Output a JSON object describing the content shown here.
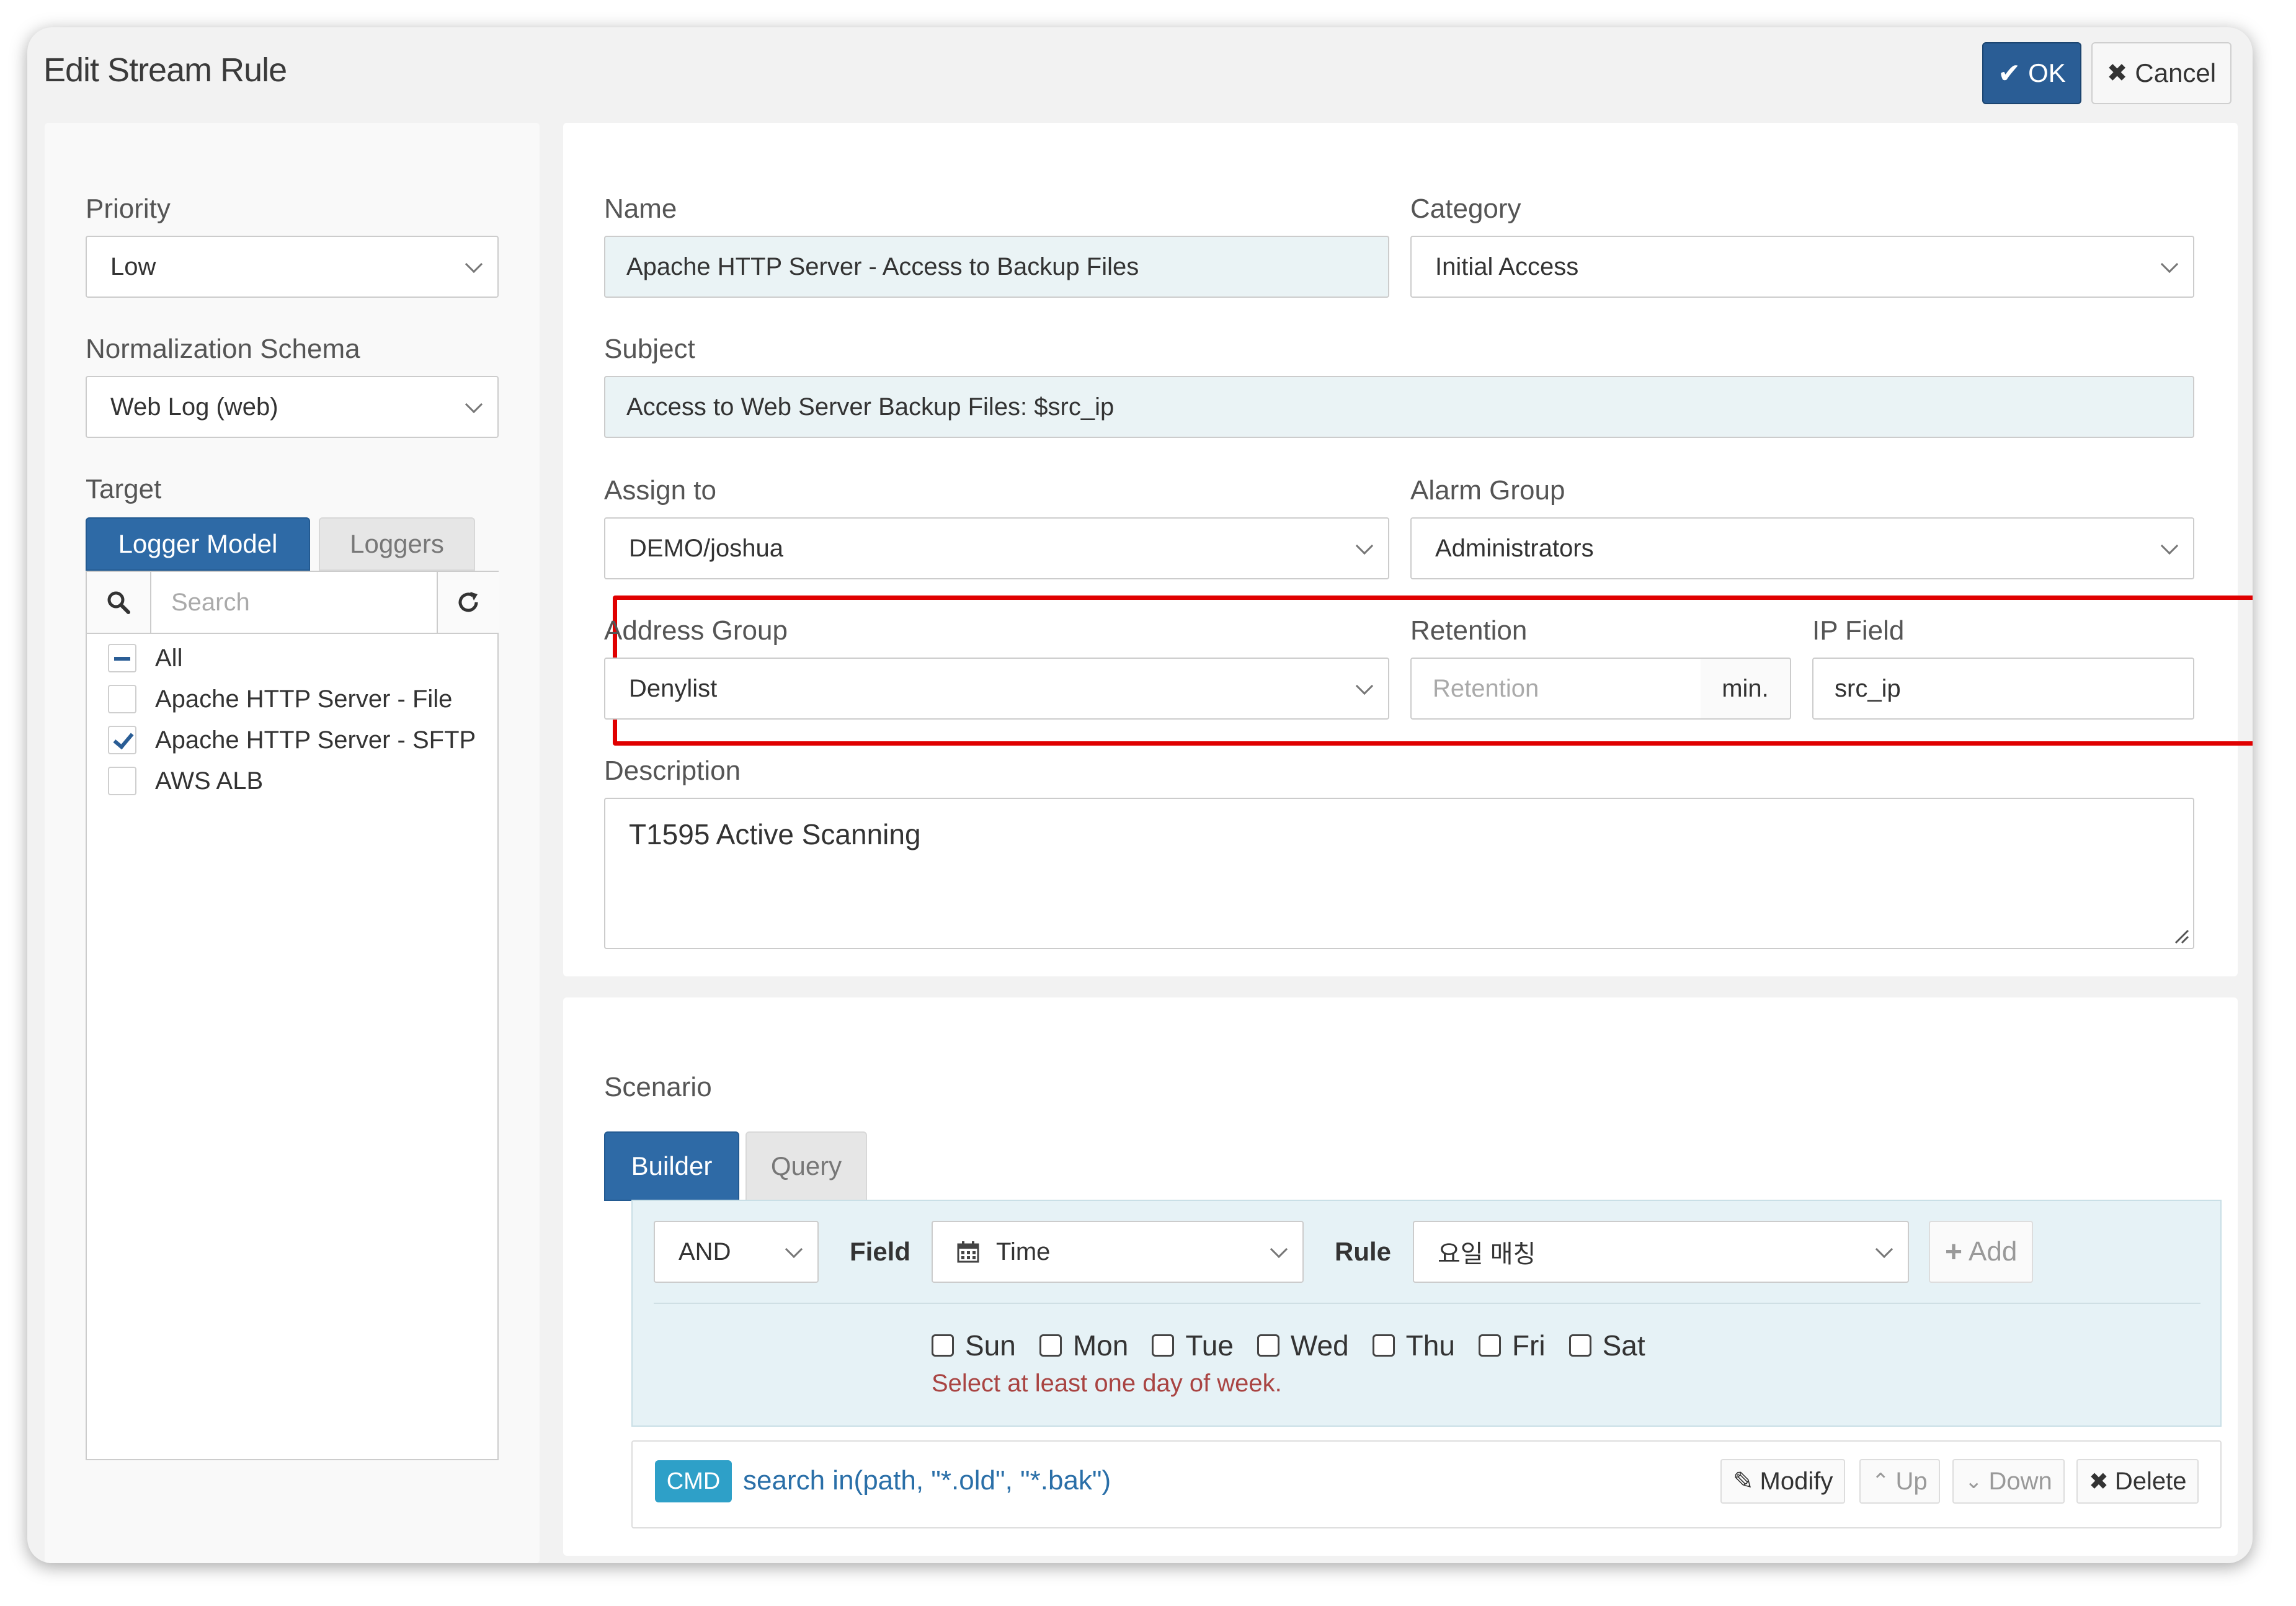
{
  "dialog": {
    "title": "Edit Stream Rule",
    "ok_label": "OK",
    "cancel_label": "Cancel"
  },
  "left": {
    "priority_label": "Priority",
    "priority_value": "Low",
    "schema_label": "Normalization Schema",
    "schema_value": "Web Log (web)",
    "target_label": "Target",
    "tabs": [
      {
        "label": "Logger Model",
        "active": true
      },
      {
        "label": "Loggers",
        "active": false
      }
    ],
    "search_placeholder": "Search",
    "items": [
      {
        "label": "All",
        "state": "indeterminate"
      },
      {
        "label": "Apache HTTP Server - File",
        "state": "unchecked"
      },
      {
        "label": "Apache HTTP Server - SFTP",
        "state": "checked"
      },
      {
        "label": "AWS ALB",
        "state": "unchecked"
      }
    ]
  },
  "form": {
    "name_label": "Name",
    "name_value": "Apache HTTP Server - Access to Backup Files",
    "category_label": "Category",
    "category_value": "Initial Access",
    "subject_label": "Subject",
    "subject_value": "Access to Web Server Backup Files: $src_ip",
    "assign_label": "Assign to",
    "assign_value": "DEMO/joshua",
    "alarm_label": "Alarm Group",
    "alarm_value": "Administrators",
    "address_label": "Address Group",
    "address_value": "Denylist",
    "retention_label": "Retention",
    "retention_placeholder": "Retention",
    "retention_unit": "min.",
    "ipfield_label": "IP Field",
    "ipfield_value": "src_ip",
    "description_label": "Description",
    "description_value": "T1595 Active Scanning"
  },
  "scenario": {
    "label": "Scenario",
    "tabs": [
      {
        "label": "Builder",
        "active": true
      },
      {
        "label": "Query",
        "active": false
      }
    ],
    "logic_value": "AND",
    "field_label": "Field",
    "field_value": "Time",
    "rule_label": "Rule",
    "rule_value": "요일 매칭",
    "add_label": "Add",
    "days": [
      "Sun",
      "Mon",
      "Tue",
      "Wed",
      "Thu",
      "Fri",
      "Sat"
    ],
    "error": "Select at least one day of week.",
    "cmd_badge": "CMD",
    "cmd_text": "search in(path, \"*.old\", \"*.bak\")",
    "actions": {
      "modify": "Modify",
      "up": "Up",
      "down": "Down",
      "delete": "Delete"
    }
  },
  "colors": {
    "primary": "#2a5d95",
    "highlight": "#e00000",
    "error": "#a94442",
    "cmd_badge": "#2ea0c8",
    "cmd_text": "#2a6fa8"
  }
}
